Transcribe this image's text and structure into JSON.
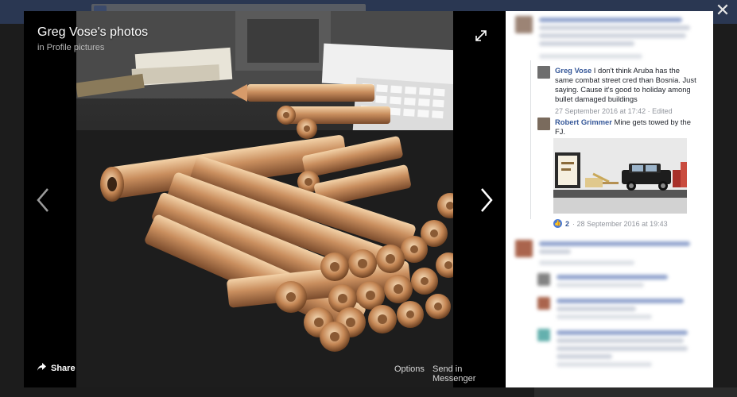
{
  "window": {
    "close_icon": "close-icon"
  },
  "viewer": {
    "title": "Greg Vose's photos",
    "album": "in Profile pictures",
    "share_label": "Share",
    "options_label": "Options",
    "messenger_label": "Send in Messenger"
  },
  "comments": [
    {
      "author": "Greg Vose",
      "text": " I don't think Aruba has the same combat street cred than Bosnia. Just saying. Cause it's good to holiday among bullet damaged buildings",
      "meta": "27 September 2016 at 17:42 · Edited"
    },
    {
      "author": "Robert Grimmer",
      "text": " Mine gets towed by the FJ.",
      "likes": "2",
      "meta": "· 28 September 2016 at 19:43"
    }
  ],
  "colors": {
    "link": "#365899",
    "panel_bg": "#ffffff",
    "viewer_bg": "#000000"
  }
}
